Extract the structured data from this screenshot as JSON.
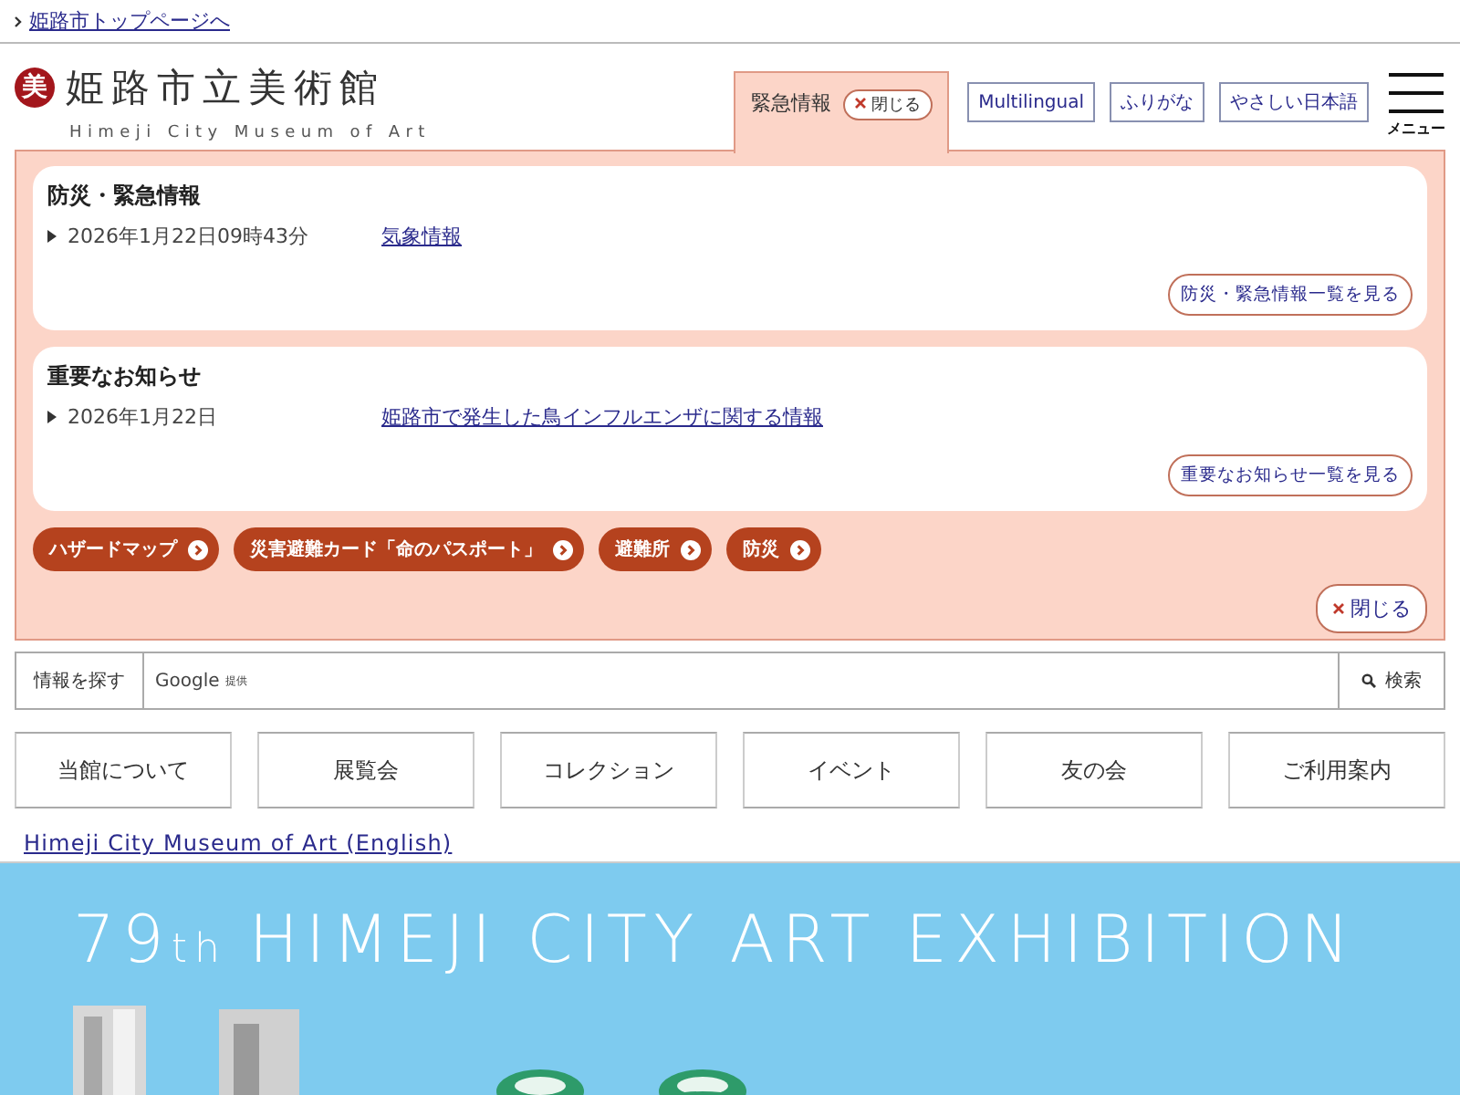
{
  "top_link": "姫路市トップページへ",
  "header": {
    "logo_mark": "美",
    "logo_title": "姫路市立美術館",
    "logo_subtitle": "Himeji City Museum of Art",
    "emergency_tab": {
      "label": "緊急情報",
      "close": "閉じる",
      "selected": true
    },
    "tools": [
      "Multilingual",
      "ふりがな",
      "やさしい日本語"
    ],
    "menu_label": "メニュー"
  },
  "emergency": {
    "sections": [
      {
        "title": "防災・緊急情報",
        "items": [
          {
            "date": "2026年1月22日09時43分",
            "link": "気象情報"
          }
        ],
        "more": "防災・緊急情報一覧を見る"
      },
      {
        "title": "重要なお知らせ",
        "items": [
          {
            "date": "2026年1月22日",
            "link": "姫路市で発生した鳥インフルエンザに関する情報"
          }
        ],
        "more": "重要なお知らせ一覧を見る"
      }
    ],
    "quick_links": [
      "ハザードマップ",
      "災害避難カード「命のパスポート」",
      "避難所",
      "防災"
    ],
    "close": "閉じる"
  },
  "search": {
    "label": "情報を探す",
    "provider": "Google",
    "provider_note": "提供",
    "button": "検索"
  },
  "nav": [
    "当館について",
    "展覧会",
    "コレクション",
    "イベント",
    "友の会",
    "ご利用案内"
  ],
  "english_link": "Himeji City Museum of Art (English)",
  "banner": {
    "title": "79",
    "title_suffix": "th",
    "title_rest": "HIMEJI CITY ART EXHIBITION",
    "kind": "picture"
  }
}
